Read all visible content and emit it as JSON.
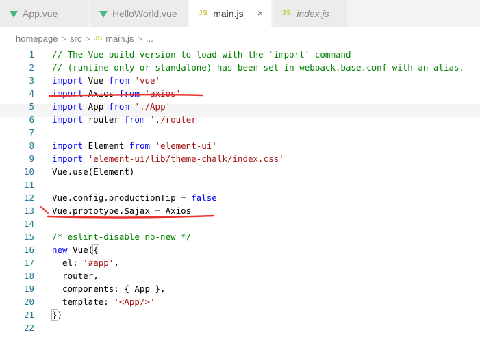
{
  "tabs": [
    {
      "label": "App.vue",
      "icon": "vue-icon",
      "active": false
    },
    {
      "label": "HelloWorld.vue",
      "icon": "vue-icon",
      "active": false
    },
    {
      "label": "main.js",
      "icon": "js-icon",
      "active": true,
      "close": "×"
    },
    {
      "label": "index.js",
      "icon": "js-icon",
      "active": false,
      "italic": true
    }
  ],
  "js_icon_text": "JS",
  "breadcrumb": {
    "parts": [
      "homepage",
      "src",
      "main.js",
      "..."
    ],
    "separator": ">"
  },
  "colors": {
    "comment": "#008000",
    "keyword": "#0000ff",
    "string": "#a31515",
    "line_number": "#237893",
    "annotation": "#e8332f"
  },
  "lines": [
    {
      "n": "1",
      "tokens": [
        [
          "c",
          "// The Vue build version to load with the `import` command"
        ]
      ]
    },
    {
      "n": "2",
      "tokens": [
        [
          "c",
          "// (runtime-only or standalone) has been set in webpack.base.conf with an alias."
        ]
      ]
    },
    {
      "n": "3",
      "tokens": [
        [
          "k",
          "import"
        ],
        [
          "t",
          " Vue "
        ],
        [
          "k",
          "from"
        ],
        [
          "t",
          " "
        ],
        [
          "s",
          "'vue'"
        ]
      ]
    },
    {
      "n": "4",
      "tokens": [
        [
          "k",
          "import"
        ],
        [
          "t",
          " Axios "
        ],
        [
          "k",
          "from"
        ],
        [
          "t",
          " "
        ],
        [
          "s",
          "'axios'"
        ]
      ]
    },
    {
      "n": "5",
      "tokens": [
        [
          "k",
          "import"
        ],
        [
          "t",
          " App "
        ],
        [
          "k",
          "from"
        ],
        [
          "t",
          " "
        ],
        [
          "s",
          "'./App'"
        ]
      ]
    },
    {
      "n": "6",
      "tokens": [
        [
          "k",
          "import"
        ],
        [
          "t",
          " router "
        ],
        [
          "k",
          "from"
        ],
        [
          "t",
          " "
        ],
        [
          "s",
          "'./router'"
        ]
      ]
    },
    {
      "n": "7",
      "tokens": []
    },
    {
      "n": "8",
      "tokens": [
        [
          "k",
          "import"
        ],
        [
          "t",
          " Element "
        ],
        [
          "k",
          "from"
        ],
        [
          "t",
          " "
        ],
        [
          "s",
          "'element-ui'"
        ]
      ]
    },
    {
      "n": "9",
      "tokens": [
        [
          "k",
          "import"
        ],
        [
          "t",
          " "
        ],
        [
          "s",
          "'element-ui/lib/theme-chalk/index.css'"
        ]
      ]
    },
    {
      "n": "10",
      "tokens": [
        [
          "t",
          "Vue.use(Element)"
        ]
      ]
    },
    {
      "n": "11",
      "tokens": []
    },
    {
      "n": "12",
      "tokens": [
        [
          "t",
          "Vue.config.productionTip = "
        ],
        [
          "k",
          "false"
        ]
      ]
    },
    {
      "n": "13",
      "tokens": [
        [
          "t",
          "Vue.prototype.$ajax = Axios"
        ]
      ]
    },
    {
      "n": "14",
      "tokens": []
    },
    {
      "n": "15",
      "tokens": [
        [
          "c",
          "/* eslint-disable no-new */"
        ]
      ]
    },
    {
      "n": "16",
      "tokens": [
        [
          "k",
          "new"
        ],
        [
          "t",
          " Vue("
        ],
        [
          "b",
          "{"
        ]
      ]
    },
    {
      "n": "17",
      "tokens": [
        [
          "t",
          "  el: "
        ],
        [
          "s",
          "'#app'"
        ],
        [
          "t",
          ","
        ]
      ]
    },
    {
      "n": "18",
      "tokens": [
        [
          "t",
          "  router,"
        ]
      ]
    },
    {
      "n": "19",
      "tokens": [
        [
          "t",
          "  components: { App },"
        ]
      ]
    },
    {
      "n": "20",
      "tokens": [
        [
          "t",
          "  template: "
        ],
        [
          "s",
          "'<App/>'"
        ]
      ]
    },
    {
      "n": "21",
      "tokens": [
        [
          "b",
          "}"
        ],
        [
          "t",
          ")"
        ]
      ]
    },
    {
      "n": "22",
      "tokens": []
    }
  ]
}
